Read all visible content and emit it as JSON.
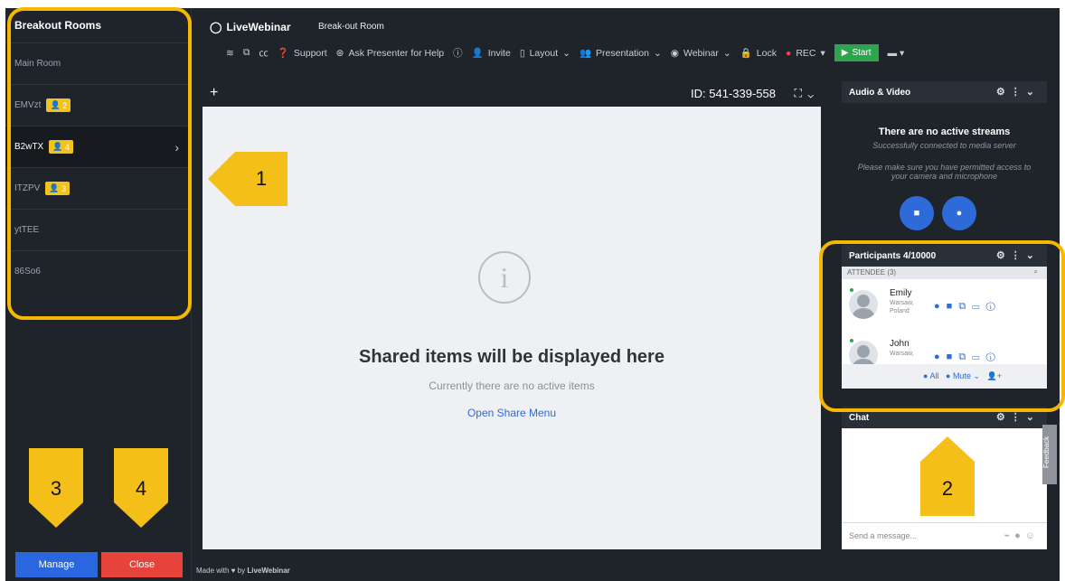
{
  "sidebar": {
    "title": "Breakout Rooms",
    "rooms": [
      {
        "name": "Main Room"
      },
      {
        "name": "EMVzt",
        "count": "2"
      },
      {
        "name": "B2wTX",
        "count": "4"
      },
      {
        "name": "ITZPV",
        "count": "3"
      },
      {
        "name": "ytTEE"
      },
      {
        "name": "86So6"
      }
    ],
    "manage_label": "Manage",
    "close_label": "Close"
  },
  "topbar": {
    "brand": "LiveWebinar",
    "room_title": "Break-out Room",
    "items": [
      "Support",
      "Ask Presenter for Help",
      "Invite",
      "Layout",
      "Presentation",
      "Webinar",
      "Lock",
      "REC",
      "Start"
    ]
  },
  "stage": {
    "meeting_id": "ID: 541-339-558",
    "title": "Shared items will be displayed here",
    "subtitle": "Currently there are no active items",
    "link": "Open Share Menu"
  },
  "audio_video": {
    "title": "Audio & Video",
    "no_streams": "There are no active streams",
    "connected": "Successfully connected to media server",
    "permission": "Please make sure you have permitted access to your camera and microphone"
  },
  "participants": {
    "title": "Participants 4/10000",
    "attendee_label": "ATTENDEE",
    "attendee_count": "(3)",
    "list": [
      {
        "name": "Emily",
        "location": "Warsaw, Poland"
      },
      {
        "name": "John",
        "location": "Warsaw, Poland"
      }
    ],
    "all_label": "All",
    "mute_label": "Mute"
  },
  "chat": {
    "title": "Chat",
    "placeholder": "Send a message..."
  },
  "feedback": "Feedback",
  "footer": {
    "made_with": "Made with ♥ by",
    "brand": "LiveWebinar"
  },
  "callouts": [
    "1",
    "2",
    "3",
    "4"
  ],
  "colors": {
    "accent": "#f5b700",
    "blue": "#2f6ad9",
    "red": "#e8433a",
    "green": "#2ea44f"
  }
}
